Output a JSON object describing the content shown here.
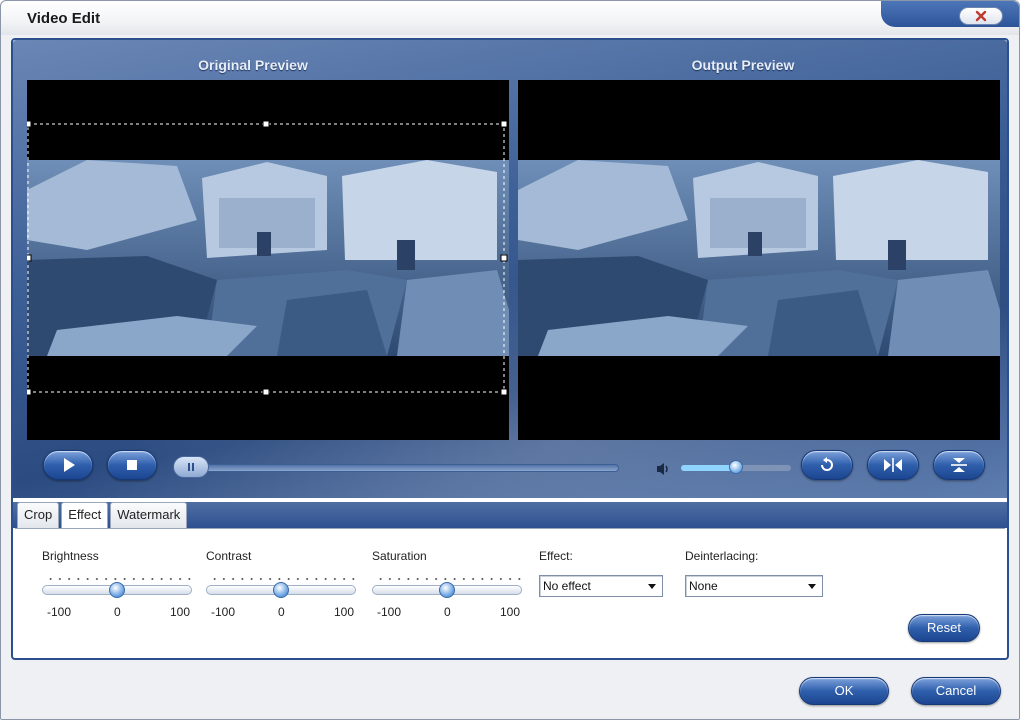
{
  "window": {
    "title": "Video Edit"
  },
  "preview": {
    "original_label": "Original Preview",
    "output_label": "Output Preview"
  },
  "playback": {
    "play_icon": "play-icon",
    "stop_icon": "stop-icon",
    "seek_progress": 0.0,
    "volume_level": 0.5
  },
  "tabs": [
    {
      "label": "Crop"
    },
    {
      "label": "Effect"
    },
    {
      "label": "Watermark"
    }
  ],
  "active_tab": "Effect",
  "sliders": [
    {
      "label": "Brightness",
      "min": "-100",
      "mid": "0",
      "max": "100",
      "value": 0
    },
    {
      "label": "Contrast",
      "min": "-100",
      "mid": "0",
      "max": "100",
      "value": 0
    },
    {
      "label": "Saturation",
      "min": "-100",
      "mid": "0",
      "max": "100",
      "value": 0
    }
  ],
  "effect": {
    "label": "Effect:",
    "value": "No effect"
  },
  "deinterlacing": {
    "label": "Deinterlacing:",
    "value": "None"
  },
  "buttons": {
    "reset": "Reset",
    "ok": "OK",
    "cancel": "Cancel"
  },
  "colors": {
    "accent": "#2f5fac",
    "frame": "#2b4f8c",
    "video_tint": "#4a6e9c"
  }
}
